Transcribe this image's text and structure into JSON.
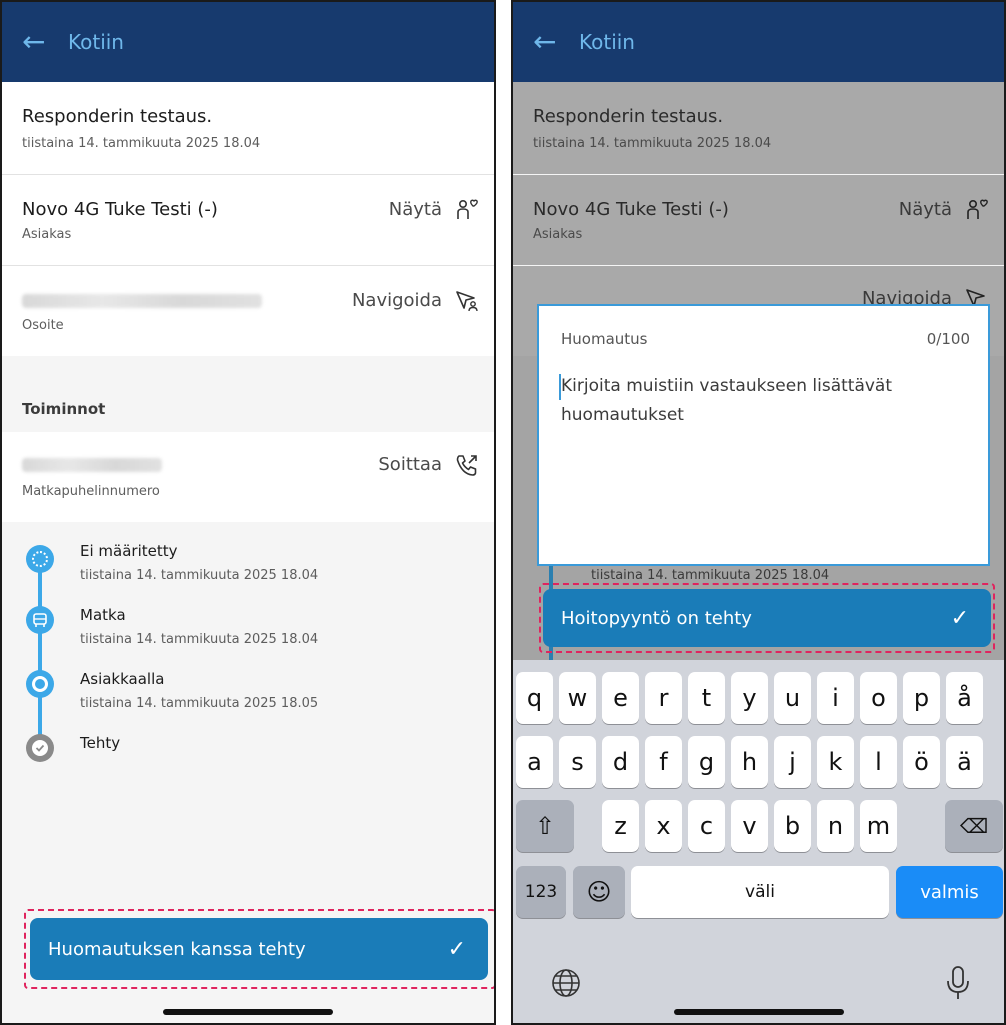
{
  "left": {
    "appbar": {
      "back_icon": "arrow-left-icon",
      "title": "Kotiin"
    },
    "header": {
      "title": "Responderin testaus.",
      "date": "tiistaina 14. tammikuuta 2025 18.04"
    },
    "customer": {
      "name": "Novo 4G  Tuke Testi (-)",
      "sublabel": "Asiakas",
      "action": "Näytä",
      "icon": "person-heart-icon"
    },
    "address": {
      "sublabel": "Osoite",
      "action": "Navigoida",
      "icon": "navigate-person-icon"
    },
    "section_title": "Toiminnot",
    "phone": {
      "sublabel": "Matkapuhelinnumero",
      "action": "Soittaa",
      "icon": "phone-call-icon"
    },
    "timeline": [
      {
        "label": "Ei määritetty",
        "time": "tiistaina 14. tammikuuta 2025 18.04",
        "icon": "dotted-circle-icon"
      },
      {
        "label": "Matka",
        "time": "tiistaina 14. tammikuuta 2025 18.04",
        "icon": "car-icon"
      },
      {
        "label": "Asiakkaalla",
        "time": "tiistaina 14. tammikuuta 2025 18.05",
        "icon": "target-icon"
      },
      {
        "label": "Tehty",
        "time": "",
        "icon": "check-circle-icon"
      }
    ],
    "done_button": {
      "label": "Huomautuksen kanssa tehty",
      "icon": "check-icon"
    }
  },
  "right": {
    "appbar": {
      "back_icon": "arrow-left-icon",
      "title": "Kotiin"
    },
    "header": {
      "title": "Responderin testaus.",
      "date": "tiistaina 14. tammikuuta 2025 18.04"
    },
    "customer": {
      "name": "Novo 4G  Tuke Testi (-)",
      "sublabel": "Asiakas",
      "action": "Näytä"
    },
    "address": {
      "action": "Navigoida"
    },
    "behind_time": "tiistaina 14. tammikuuta 2025 18.04",
    "note": {
      "label": "Huomautus",
      "counter": "0/100",
      "placeholder": "Kirjoita muistiin vastaukseen lisättävät huomautukset"
    },
    "done_button": {
      "label": "Hoitopyyntö on tehty",
      "icon": "check-icon"
    },
    "keyboard": {
      "row1": [
        "q",
        "w",
        "e",
        "r",
        "t",
        "y",
        "u",
        "i",
        "o",
        "p",
        "å"
      ],
      "row2": [
        "a",
        "s",
        "d",
        "f",
        "g",
        "h",
        "j",
        "k",
        "l",
        "ö",
        "ä"
      ],
      "row3": [
        "z",
        "x",
        "c",
        "v",
        "b",
        "n",
        "m"
      ],
      "shift_icon": "shift-icon",
      "backspace_icon": "backspace-icon",
      "numbers": "123",
      "emoji_icon": "emoji-icon",
      "space": "väli",
      "done": "valmis",
      "globe_icon": "globe-icon",
      "mic_icon": "microphone-icon"
    }
  },
  "colors": {
    "appbar": "#173a6e",
    "accent": "#6fb7ea",
    "button": "#1a7cb8",
    "timeline": "#3ca8e8",
    "highlight": "#e0245e"
  }
}
